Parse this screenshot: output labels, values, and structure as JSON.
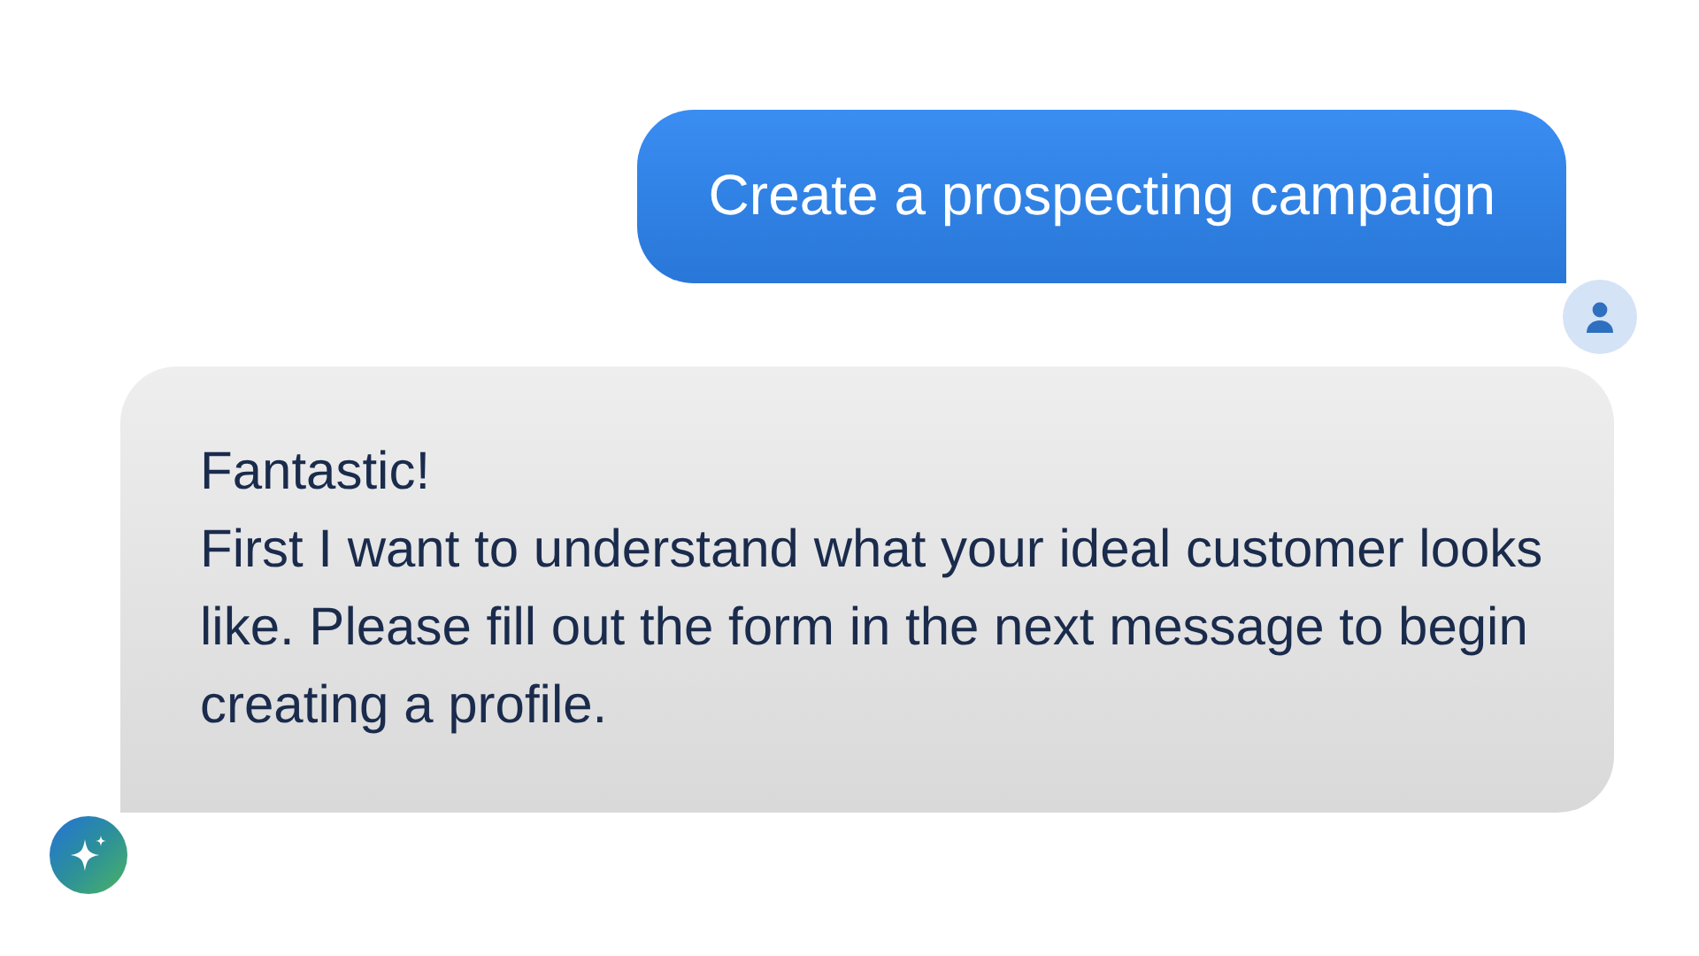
{
  "messages": [
    {
      "kind": "user",
      "paragraphs": [
        "Create a prospecting campaign"
      ]
    },
    {
      "kind": "assistant",
      "paragraphs": [
        "Fantastic!",
        "First I want to understand what your ideal customer looks like. Please fill out the form in the next message to begin creating a profile."
      ]
    }
  ]
}
